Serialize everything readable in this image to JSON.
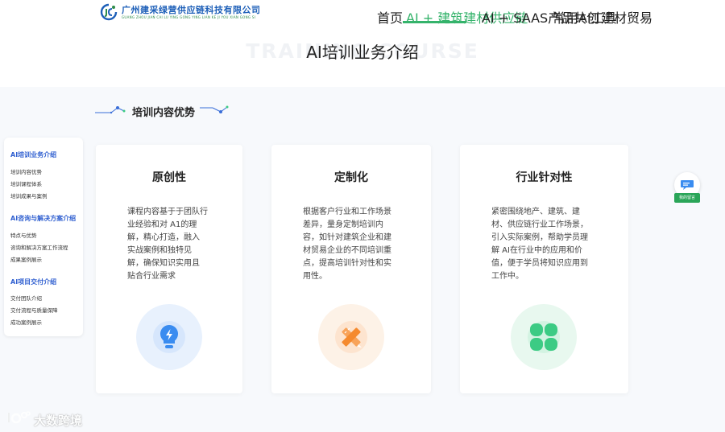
{
  "header": {
    "logo_text": "广州建采绿营供应链科技有限公司",
    "logo_sub": "GUANG ZHOU JIAN CAI LU YING GONG YING LIAN KE JI YOU XIAN GONG SI",
    "nav": [
      {
        "label": "首页",
        "active": false
      },
      {
        "label": "AI + 建筑建材供应链",
        "active": true
      },
      {
        "label": "AI + SAAS产品共创",
        "active": false
      },
      {
        "label": "常用AI工具",
        "active": false
      },
      {
        "label": "建材贸易",
        "active": false
      }
    ]
  },
  "hero": {
    "bg_text": "TRAINING COURSE",
    "title": "AI培训业务介绍"
  },
  "section": {
    "title": "培训内容优势"
  },
  "sidebar": {
    "groups": [
      {
        "title": "AI培训业务介绍",
        "items": [
          "培训内容优势",
          "培训课程体系",
          "培训成果与案例"
        ]
      },
      {
        "title": "AI咨询与解决方案介绍",
        "items": [
          "特点与优势",
          "咨询和解决方案工作流程",
          "成果案例展示"
        ]
      },
      {
        "title": "AI项目交付介绍",
        "items": [
          "交付团队介绍",
          "交付流程与质量保障",
          "成功案例展示"
        ]
      }
    ]
  },
  "cards": [
    {
      "title": "原创性",
      "lines": [
        "课程内容基于于团队行",
        "业经验和对 A1的理",
        "解，精心打造，融入",
        "实战案例和独特见",
        "解，确保知识实用且",
        "贴合行业需求"
      ],
      "icon": "lightning-bulb-icon",
      "color": "#3a8cf0",
      "halo": "#e6f0fd"
    },
    {
      "title": "定制化",
      "lines": [
        "根据客户行业和工作场景",
        "差异，量身定制培训内",
        "容，如针对建筑企业和建",
        "材贸易企业的不同培训重",
        "点，提高培训针对性和实",
        "用性。"
      ],
      "icon": "ruler-pencil-icon",
      "color": "#f58a2e",
      "halo": "#fdf0e4"
    },
    {
      "title": "行业针对性",
      "lines": [
        "紧密围绕地产、建筑、建",
        "材、供应链行业工作场景，",
        "引入实际案例，帮助学员理",
        "解 AI在行业中的应用和价",
        "值，便于学员将知识应用到",
        "工作中。"
      ],
      "icon": "clover-icon",
      "color": "#3ccb84",
      "halo": "#e4f8ee"
    }
  ],
  "float_button": {
    "label": "我的留言"
  },
  "watermark": {
    "text": "大数跨境"
  }
}
